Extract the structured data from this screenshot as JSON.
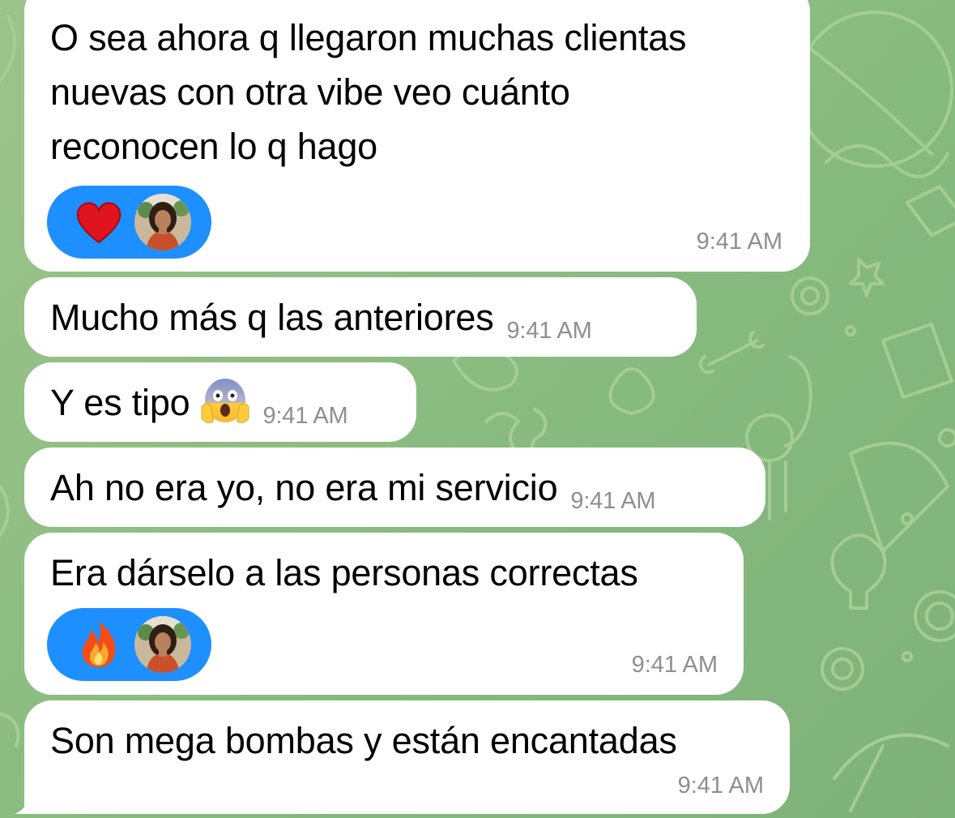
{
  "chat": {
    "messages": [
      {
        "text_lines": [
          "O sea ahora q llegaron muchas clientas",
          "nuevas con otra vibe veo cuánto",
          "reconocen lo q hago"
        ],
        "time": "9:41 AM",
        "reaction": "heart"
      },
      {
        "text": "Mucho más q las anteriores",
        "time": "9:41 AM"
      },
      {
        "text": "Y es tipo",
        "emoji": "face-screaming-in-fear",
        "time": "9:41 AM"
      },
      {
        "text": "Ah no era yo, no era mi servicio",
        "time": "9:41 AM"
      },
      {
        "text": "Era dárselo a las personas correctas",
        "time": "9:41 AM",
        "reaction": "fire"
      },
      {
        "text": "Son mega bombas y están encantadas",
        "time": "9:41 AM"
      }
    ]
  },
  "colors": {
    "bubble": "#ffffff",
    "reaction_pill": "#1e8fff",
    "timestamp": "#8e8e93",
    "background": "#8fbe83"
  },
  "icons": [
    "heart-icon",
    "fire-icon",
    "scream-emoji-icon",
    "reactor-avatar"
  ]
}
